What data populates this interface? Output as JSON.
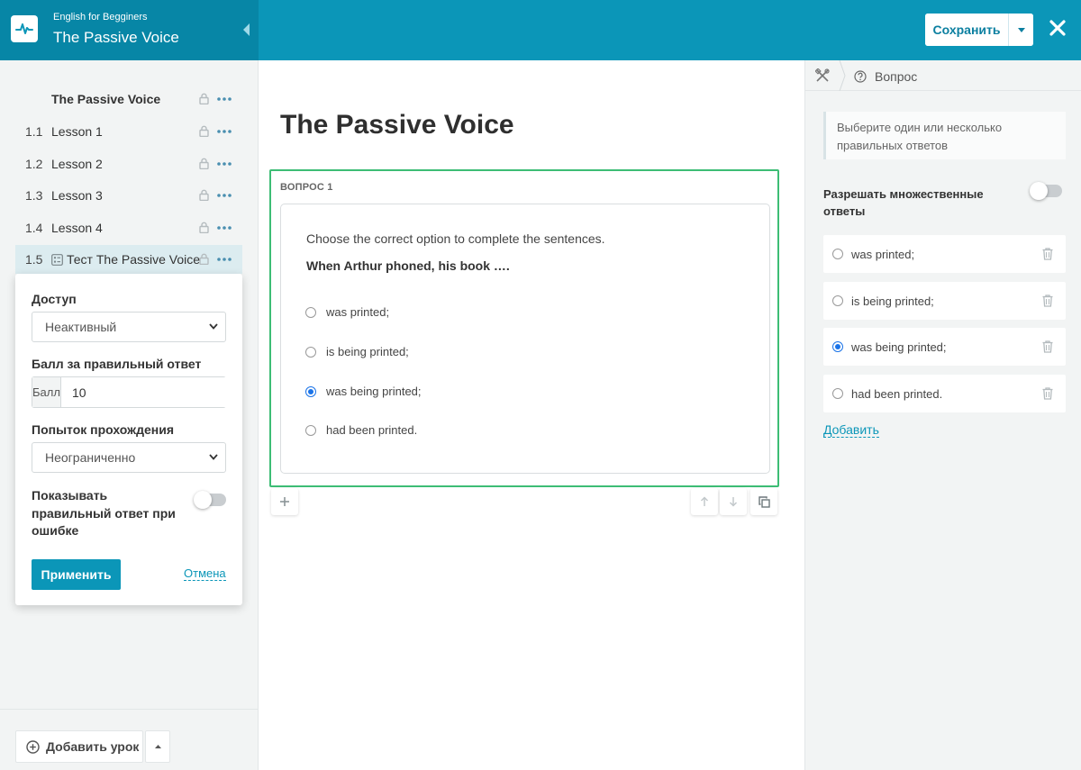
{
  "header": {
    "course_subtitle": "English for Begginers",
    "course_title": "The Passive Voice",
    "save_label": "Сохранить"
  },
  "sidebar": {
    "lessons": [
      {
        "num": "",
        "label": "The Passive Voice"
      },
      {
        "num": "1.1",
        "label": "Lesson 1"
      },
      {
        "num": "1.2",
        "label": "Lesson 2"
      },
      {
        "num": "1.3",
        "label": "Lesson 3"
      },
      {
        "num": "1.4",
        "label": "Lesson 4"
      },
      {
        "num": "1.5",
        "label": "Тест The Passive Voice"
      }
    ],
    "add_lesson_label": "Добавить урок"
  },
  "settings_popup": {
    "access_label": "Доступ",
    "access_value": "Неактивный",
    "score_label": "Балл за правильный ответ",
    "score_addon": "Балл",
    "score_value": "10",
    "attempts_label": "Попыток прохождения",
    "attempts_value": "Неограниченно",
    "show_answer_label": "Показывать правильный ответ при ошибке",
    "apply_label": "Применить",
    "cancel_label": "Отмена"
  },
  "main": {
    "title": "The Passive Voice",
    "question_label": "ВОПРОС 1",
    "instruction": "Choose the correct option to complete the sentences.",
    "question_text": "When Arthur phoned, his book ….",
    "options": [
      "was printed;",
      "is being printed;",
      "was being printed;",
      "had been printed."
    ],
    "selected_index": 2
  },
  "right_panel": {
    "tab_label": "Вопрос",
    "hint": "Выберите один или несколько правильных ответов",
    "multi_label": "Разрешать множественные ответы",
    "answers": [
      "was printed;",
      "is being printed;",
      "was being printed;",
      "had been printed."
    ],
    "add_label": "Добавить"
  },
  "colors": {
    "header": "#0b96b8",
    "header_dark": "#0786a6",
    "accent_green": "#3dbd75",
    "link": "#0b96b8"
  }
}
